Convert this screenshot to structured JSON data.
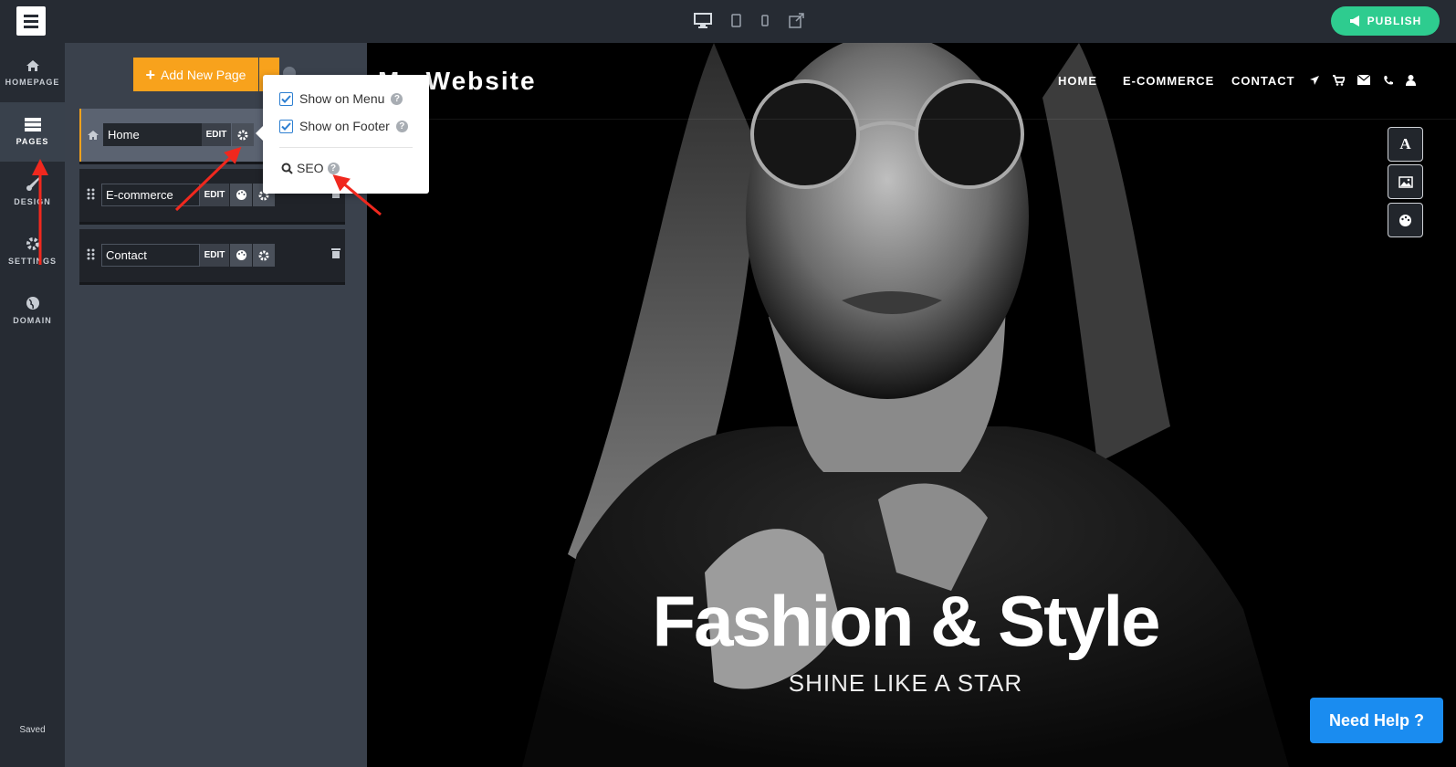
{
  "topbar": {
    "devices": [
      "desktop-icon",
      "tablet-icon",
      "mobile-icon",
      "external-link-icon"
    ],
    "publish_label": "PUBLISH"
  },
  "sidebar": {
    "items": [
      {
        "label": "HOMEPAGE",
        "icon": "home-icon"
      },
      {
        "label": "PAGES",
        "icon": "pages-icon",
        "active": true
      },
      {
        "label": "DESIGN",
        "icon": "brush-icon"
      },
      {
        "label": "SETTINGS",
        "icon": "gear-icon"
      },
      {
        "label": "DOMAIN",
        "icon": "globe-icon"
      }
    ],
    "status": "Saved"
  },
  "pages_panel": {
    "add_button": "Add New Page",
    "pages": [
      {
        "name": "Home",
        "edit": "EDIT"
      },
      {
        "name": "E-commerce",
        "edit": "EDIT"
      },
      {
        "name": "Contact",
        "edit": "EDIT"
      }
    ]
  },
  "popover": {
    "show_on_menu": "Show on Menu",
    "show_on_footer": "Show on Footer",
    "seo": "SEO"
  },
  "site": {
    "title": "My Website",
    "nav": [
      "HOME",
      "E-COMMERCE",
      "CONTACT"
    ],
    "nav_icons": [
      "location-icon",
      "cart-icon",
      "mail-icon",
      "phone-icon",
      "user-icon"
    ],
    "hero_title": "Fashion & Style",
    "hero_subtitle": "SHINE LIKE A STAR",
    "help_button": "Need Help ?"
  },
  "colors": {
    "accent": "#f8a21c",
    "publish": "#2ecc8f",
    "help": "#1a8cf0",
    "arrow": "#f0281e"
  }
}
